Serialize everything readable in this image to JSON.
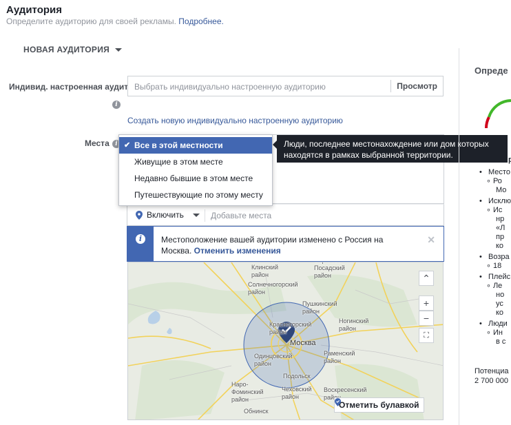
{
  "header": {
    "title": "Аудитория",
    "subtitle": "Определите аудиторию для своей рекламы.",
    "subtitle_link": "Подробнее."
  },
  "new_audience": {
    "label": "НОВАЯ АУДИТОРИЯ"
  },
  "custom_audience": {
    "label": "Индивид. настроенная аудит",
    "placeholder": "Выбрать индивидуально настроенную аудиторию",
    "browse_label": "Просмотр",
    "create_link": "Создать новую индивидуально настроенную аудиторию"
  },
  "places": {
    "label": "Места",
    "options": [
      {
        "label": "Все в этой местности",
        "selected": true
      },
      {
        "label": "Живущие в этом месте",
        "selected": false
      },
      {
        "label": "Недавно бывшие в этом месте",
        "selected": false
      },
      {
        "label": "Путешествующие по этому месту",
        "selected": false
      }
    ],
    "tooltip": "Люди, последнее местонахождение или дом которых находятся в рамках выбранной территории.",
    "include_label": "Включить",
    "add_placeholder": "Добавьте места"
  },
  "notice": {
    "message": "Местоположение вашей аудитории изменено с Россия на Москва.",
    "undo_link": "Отменить изменения"
  },
  "map": {
    "labels": {
      "klin": "Клинский\nрайон",
      "sergiev": "Сергиево-\nПосадский\nрайон",
      "solnech": "Солнечногорский\nрайон",
      "pushkin": "Пушкинский\nрайон",
      "krasnogorsk": "Красногорский\nрайон",
      "noginsk": "Ногинский\nрайон",
      "moskva": "Москва",
      "odintsovo": "Одинцовский\nрайон",
      "ramenskoe": "Раменский\nрайон",
      "podolsk": "Подольск",
      "naro": "Наро-\nФоминский\nрайон",
      "chekhov": "Чеховский\nрайон",
      "voskresensk": "Воскресенский\nрайон",
      "obninsk": "Обнинск"
    },
    "drop_pin_label": "Отметить булавкой",
    "accent": "#4267b2"
  },
  "right_panel": {
    "title": "Опреде",
    "items": [
      {
        "label": "Место",
        "sub": [
          "Ро",
          "Мо"
        ]
      },
      {
        "label": "Исклю",
        "sub": [
          "Ис",
          "нр",
          "«Л",
          "пр",
          "ко"
        ]
      },
      {
        "label": "Возра",
        "sub": [
          "18"
        ]
      },
      {
        "label": "Плейс",
        "sub": [
          "Ле",
          "но",
          "ус",
          "ко"
        ]
      },
      {
        "label": "Люди",
        "sub": [
          "Ин",
          "в с"
        ]
      }
    ],
    "potential_label": "Потенциа",
    "potential_value": "2 700 000"
  },
  "colors": {
    "link": "#365899",
    "accent": "#4267b2",
    "gauge_green": "#42b72a",
    "gauge_red": "#d0021b"
  }
}
